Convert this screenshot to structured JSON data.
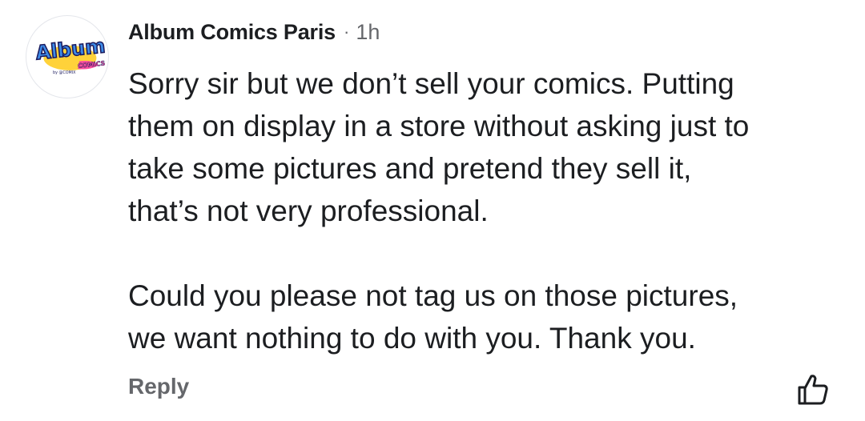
{
  "comment": {
    "author": "Album Comics Paris",
    "separator": "·",
    "time": "1h",
    "paragraphs": [
      "Sorry sir but we don’t sell your comics. Putting\nthem on display in a store without asking just to\ntake some pictures and pretend they sell it,\nthat’s not very professional.",
      "Could you please not tag us on those pictures,\nwe want nothing to do with you. Thank you."
    ],
    "reply_label": "Reply",
    "like_icon": "thumbs-up-outline-icon"
  },
  "avatar": {
    "logo_text": "Album",
    "logo_subtext": "COMICS",
    "logo_badge": "by @COMIX",
    "colors": {
      "logo_blue": "#3d8be8",
      "logo_yellow": "#ffd23a",
      "logo_pink": "#ff4fa0",
      "logo_outline": "#1b1b5e"
    }
  },
  "colors": {
    "text_primary": "#1c1e21",
    "text_secondary": "#65676b",
    "background": "#ffffff"
  }
}
